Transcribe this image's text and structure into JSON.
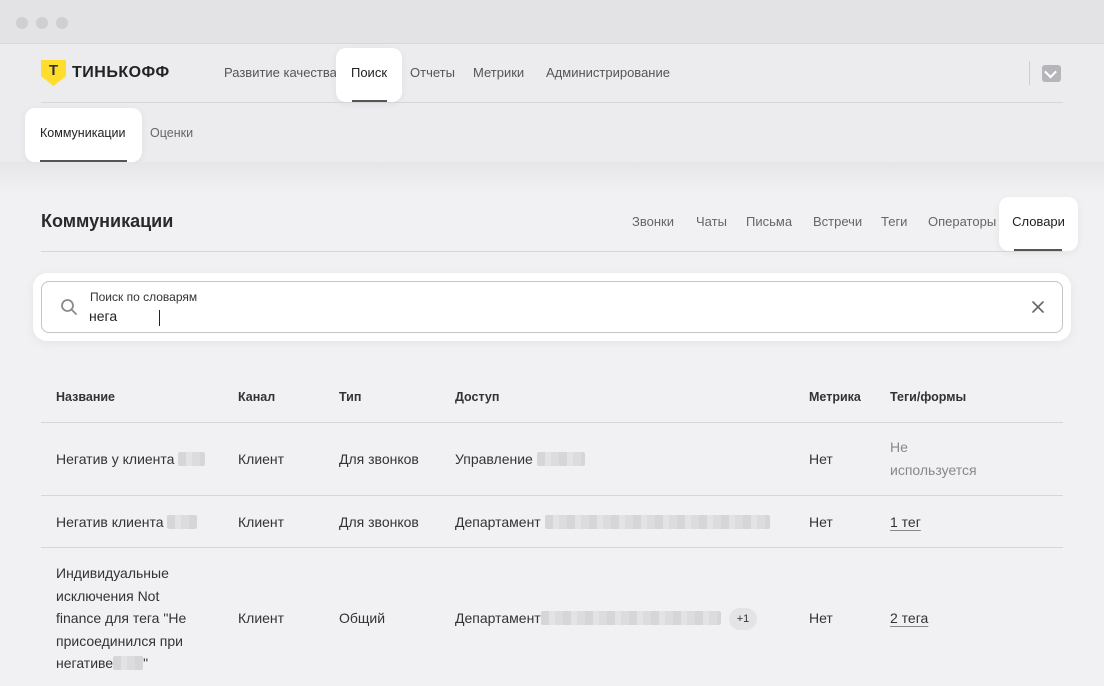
{
  "brand": {
    "logo_letter": "Т",
    "name": "ТИНЬКОФФ",
    "accent": "#ffdd2d"
  },
  "topnav": {
    "items": [
      {
        "label": "Развитие качества"
      },
      {
        "label": "Поиск",
        "active": true
      },
      {
        "label": "Отчеты"
      },
      {
        "label": "Метрики"
      },
      {
        "label": "Администрирование"
      }
    ]
  },
  "subnav": {
    "items": [
      {
        "label": "Коммуникации",
        "active": true
      },
      {
        "label": "Оценки"
      }
    ]
  },
  "page": {
    "title": "Коммуникации",
    "tabs": [
      {
        "label": "Звонки"
      },
      {
        "label": "Чаты"
      },
      {
        "label": "Письма"
      },
      {
        "label": "Встречи"
      },
      {
        "label": "Теги"
      },
      {
        "label": "Операторы"
      },
      {
        "label": "Словари",
        "active": true
      }
    ]
  },
  "search": {
    "label": "Поиск по словарям",
    "value": "нега"
  },
  "table": {
    "headers": [
      "Название",
      "Канал",
      "Тип",
      "Доступ",
      "Метрика",
      "Теги/формы"
    ],
    "rows": [
      {
        "name": "Негатив у клиента",
        "channel": "Клиент",
        "type": "Для звонков",
        "access": "Управление",
        "metric": "Нет",
        "tags_line1": "Не",
        "tags_line2": "используется"
      },
      {
        "name": "Негатив клиента",
        "channel": "Клиент",
        "type": "Для звонков",
        "access": "Департамент",
        "metric": "Нет",
        "tags": "1 тег"
      },
      {
        "name_lines": [
          "Индивидуальные",
          "исключения Not",
          "finance для тега \"Не",
          "присоединился при",
          "негативе"
        ],
        "name_suffix": "\"",
        "channel": "Клиент",
        "type": "Общий",
        "access": "Департамент",
        "access_badge": "+1",
        "metric": "Нет",
        "tags": "2 тега"
      }
    ]
  }
}
